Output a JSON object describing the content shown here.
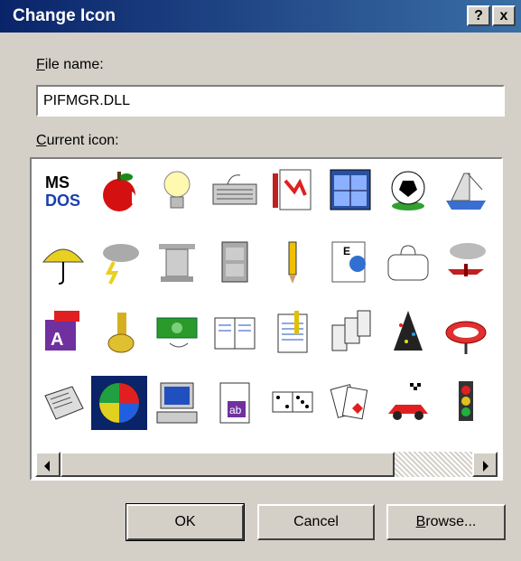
{
  "dialog": {
    "title": "Change Icon",
    "help_glyph": "?",
    "close_glyph": "x"
  },
  "file_name": {
    "label_accel": "F",
    "label_rest": "ile name:",
    "value": "PIFMGR.DLL"
  },
  "current_icon": {
    "label_accel": "C",
    "label_rest": "urrent icon:",
    "selected_index": 25,
    "icons": [
      {
        "name": "msdos-icon"
      },
      {
        "name": "apple-icon"
      },
      {
        "name": "lightbulb-icon"
      },
      {
        "name": "keyboard-icon"
      },
      {
        "name": "paint-document-icon"
      },
      {
        "name": "window-icon"
      },
      {
        "name": "soccer-ball-icon"
      },
      {
        "name": "ship-icon"
      },
      {
        "name": "umbrella-icon"
      },
      {
        "name": "storm-cloud-icon"
      },
      {
        "name": "column-icon"
      },
      {
        "name": "file-cabinet-icon"
      },
      {
        "name": "pencil-icon"
      },
      {
        "name": "eye-chart-icon"
      },
      {
        "name": "doctor-bag-icon"
      },
      {
        "name": "airplane-icon"
      },
      {
        "name": "toy-block-icon"
      },
      {
        "name": "tuba-icon"
      },
      {
        "name": "money-icon"
      },
      {
        "name": "book-icon"
      },
      {
        "name": "notepad-icon"
      },
      {
        "name": "dominoes-icon"
      },
      {
        "name": "party-hat-icon"
      },
      {
        "name": "raft-icon"
      },
      {
        "name": "newspaper-icon"
      },
      {
        "name": "beach-ball-icon"
      },
      {
        "name": "computer-icon"
      },
      {
        "name": "text-document-icon"
      },
      {
        "name": "dice-icon"
      },
      {
        "name": "playing-cards-icon"
      },
      {
        "name": "race-car-icon"
      },
      {
        "name": "traffic-light-icon"
      }
    ]
  },
  "buttons": {
    "ok": "OK",
    "cancel": "Cancel",
    "browse_accel": "B",
    "browse_rest": "rowse..."
  },
  "colors": {
    "title_bar": "#0a246a",
    "face": "#d4d0c8",
    "selection": "#0a246a"
  }
}
